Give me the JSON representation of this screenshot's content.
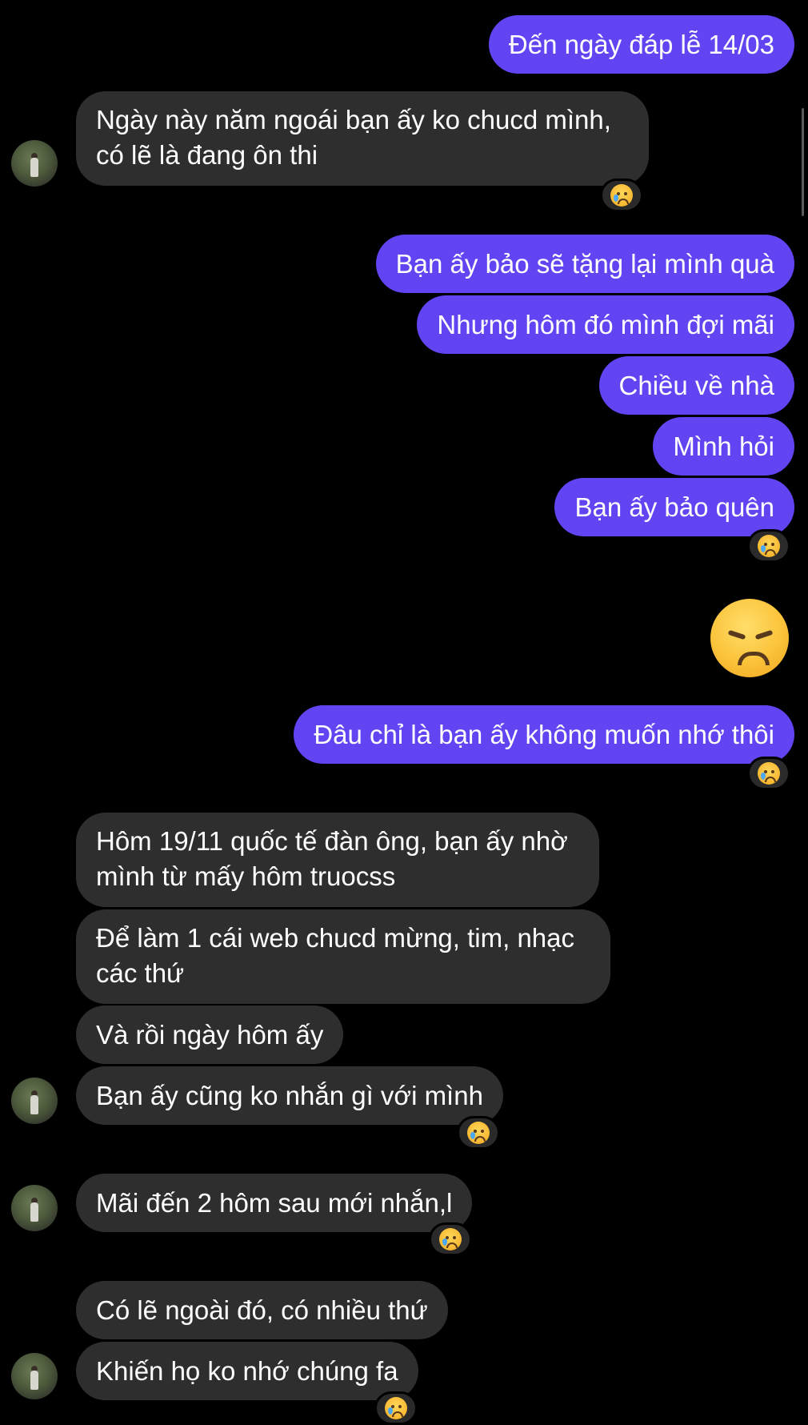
{
  "messages": {
    "m1": "Đến ngày đáp lễ 14/03",
    "m2_line1": "Ngày này năm ngoái bạn ấy ko chucd mình,",
    "m2_line2": "có lẽ là đang ôn thi",
    "m3": "Bạn ấy bảo sẽ tặng lại mình quà",
    "m4": "Nhưng hôm đó mình đợi mãi",
    "m5": "Chiều về nhà",
    "m6": "Mình hỏi",
    "m7": "Bạn ấy bảo quên",
    "m8": "Đâu chỉ là bạn ấy không muốn nhớ thôi",
    "m9_line1": "Hôm 19/11 quốc tế đàn ông, bạn ấy nhờ",
    "m9_line2": "mình từ mấy hôm truocss",
    "m10_line1": "Để làm 1 cái web chucd mừng, tim, nhạc",
    "m10_line2": "các thứ",
    "m11": "Và rồi ngày hôm ấy",
    "m12": "Bạn ấy cũng ko nhắn gì với mình",
    "m13": "Mãi đến 2 hôm sau mới nhắn,l",
    "m14": "Có lẽ ngoài đó, có nhiều thứ",
    "m15": "Khiến họ ko nhớ chúng fa"
  },
  "reactions": {
    "type": "crying-face-icon"
  },
  "colors": {
    "outgoing": "#6244f2",
    "incoming": "#2e2e2e",
    "background": "#000000"
  }
}
